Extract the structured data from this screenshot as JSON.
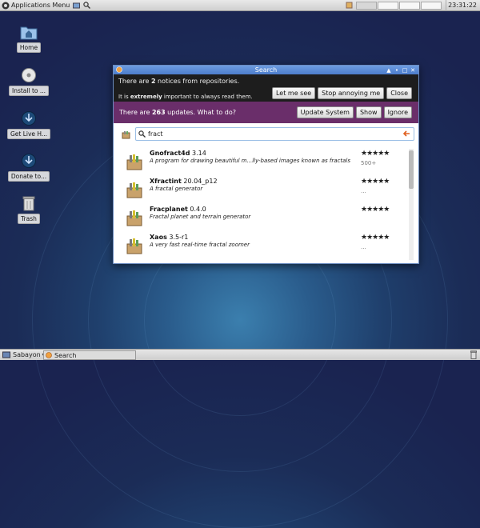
{
  "top_panel": {
    "apps_menu": "Applications Menu",
    "clock": "23:31:22"
  },
  "desktop": {
    "icons": [
      {
        "label": "Home",
        "icon": "home-folder-icon"
      },
      {
        "label": "Install to ...",
        "icon": "install-disc-icon"
      },
      {
        "label": "Get Live H...",
        "icon": "download-icon"
      },
      {
        "label": "Donate to...",
        "icon": "download-icon"
      },
      {
        "label": "Trash",
        "icon": "trash-icon"
      }
    ]
  },
  "window": {
    "title": "Search",
    "notice": {
      "pre": "There are ",
      "count": "2",
      "post": " notices from repositories.",
      "line2_pre": "It is ",
      "line2_bold": "extremely",
      "line2_post": " important to always read them.",
      "buttons": [
        "Let me see",
        "Stop annoying me",
        "Close"
      ]
    },
    "updates": {
      "pre": "There are ",
      "count": "263",
      "post": " updates. What to do?",
      "buttons": [
        "Update System",
        "Show",
        "Ignore"
      ]
    },
    "search": {
      "value": "fract"
    },
    "results": [
      {
        "name": "Gnofract4d",
        "version": "3.14",
        "description": "A program for drawing beautiful m...lly-based images known as fractals",
        "rating": "★★★★★",
        "extra": "500+"
      },
      {
        "name": "Xfractint",
        "version": "20.04_p12",
        "description": "A fractal generator",
        "rating": "★★★★★",
        "extra": "..."
      },
      {
        "name": "Fracplanet",
        "version": "0.4.0",
        "description": "Fractal planet and terrain generator",
        "rating": "★★★★★",
        "extra": ""
      },
      {
        "name": "Xaos",
        "version": "3.5-r1",
        "description": "A very fast real-time fractal zoomer",
        "rating": "★★★★★",
        "extra": "..."
      }
    ]
  },
  "bottom_panel": {
    "start_label": "Sabayon",
    "task_label": "Search"
  }
}
